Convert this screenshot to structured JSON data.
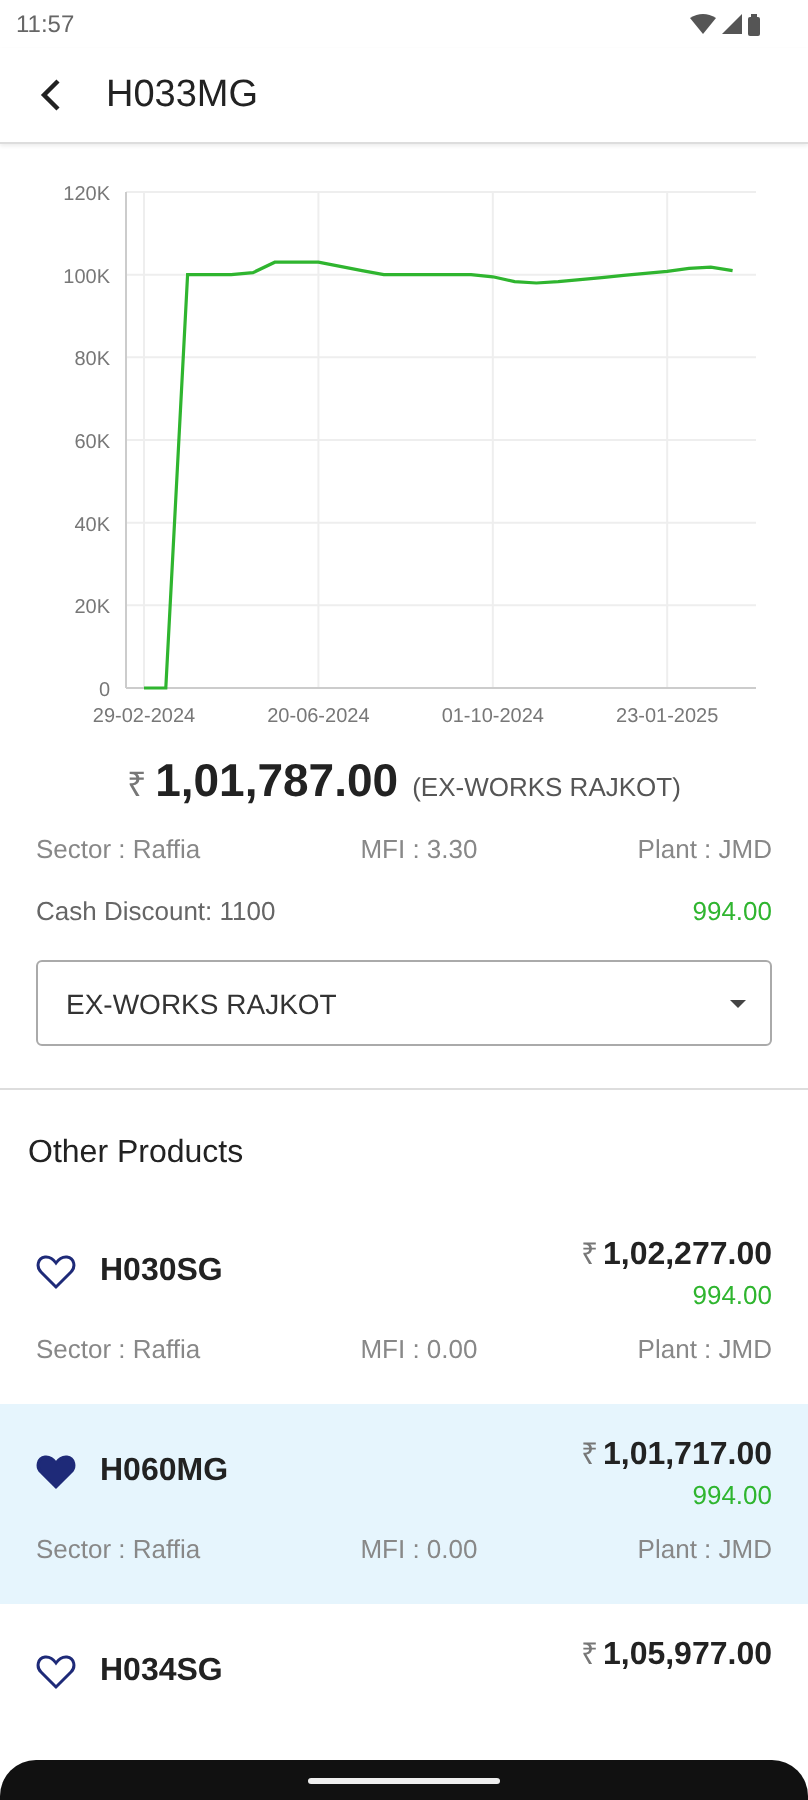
{
  "status_bar": {
    "time": "11:57"
  },
  "header": {
    "title": "H033MG"
  },
  "chart_data": {
    "type": "line",
    "ylim": [
      0,
      120000
    ],
    "yticks": [
      {
        "value": 0,
        "label": "0"
      },
      {
        "value": 20000,
        "label": "20K"
      },
      {
        "value": 40000,
        "label": "40K"
      },
      {
        "value": 60000,
        "label": "60K"
      },
      {
        "value": 80000,
        "label": "80K"
      },
      {
        "value": 100000,
        "label": "100K"
      },
      {
        "value": 120000,
        "label": "120K"
      }
    ],
    "categories": [
      "29-02-2024",
      null,
      null,
      null,
      null,
      null,
      null,
      null,
      "20-06-2024",
      null,
      null,
      null,
      null,
      null,
      null,
      null,
      "01-10-2024",
      null,
      null,
      null,
      null,
      null,
      null,
      null,
      "23-01-2025",
      null,
      null,
      null,
      null
    ],
    "grid": true,
    "series": [
      {
        "color": "#2fb52f",
        "values": [
          0,
          0,
          100000,
          100000,
          100000,
          100500,
          103000,
          103000,
          103000,
          102000,
          101000,
          100000,
          100000,
          100000,
          100000,
          100000,
          99500,
          98300,
          98000,
          98300,
          98800,
          99300,
          99800,
          100300,
          100800,
          101500,
          101800,
          101000,
          null
        ]
      }
    ]
  },
  "price": {
    "currency": "₹",
    "amount": "1,01,787.00",
    "basis": "(EX-WORKS RAJKOT)"
  },
  "details": {
    "sector": "Sector : Raffia",
    "mfi": "MFI : 3.30",
    "plant": "Plant : JMD"
  },
  "cash_discount": {
    "label": "Cash Discount: 1100",
    "value": "994.00"
  },
  "dropdown": {
    "value": "EX-WORKS RAJKOT"
  },
  "other_products": {
    "title": "Other Products",
    "items": [
      {
        "name": "H030SG",
        "favorite": false,
        "selected": false,
        "currency": "₹",
        "price": "1,02,277.00",
        "discount": "994.00",
        "sector": "Sector : Raffia",
        "mfi": "MFI : 0.00",
        "plant": "Plant : JMD"
      },
      {
        "name": "H060MG",
        "favorite": true,
        "selected": true,
        "currency": "₹",
        "price": "1,01,717.00",
        "discount": "994.00",
        "sector": "Sector : Raffia",
        "mfi": "MFI : 0.00",
        "plant": "Plant : JMD"
      },
      {
        "name": "H034SG",
        "favorite": false,
        "selected": false,
        "currency": "₹",
        "price": "1,05,977.00"
      }
    ]
  }
}
